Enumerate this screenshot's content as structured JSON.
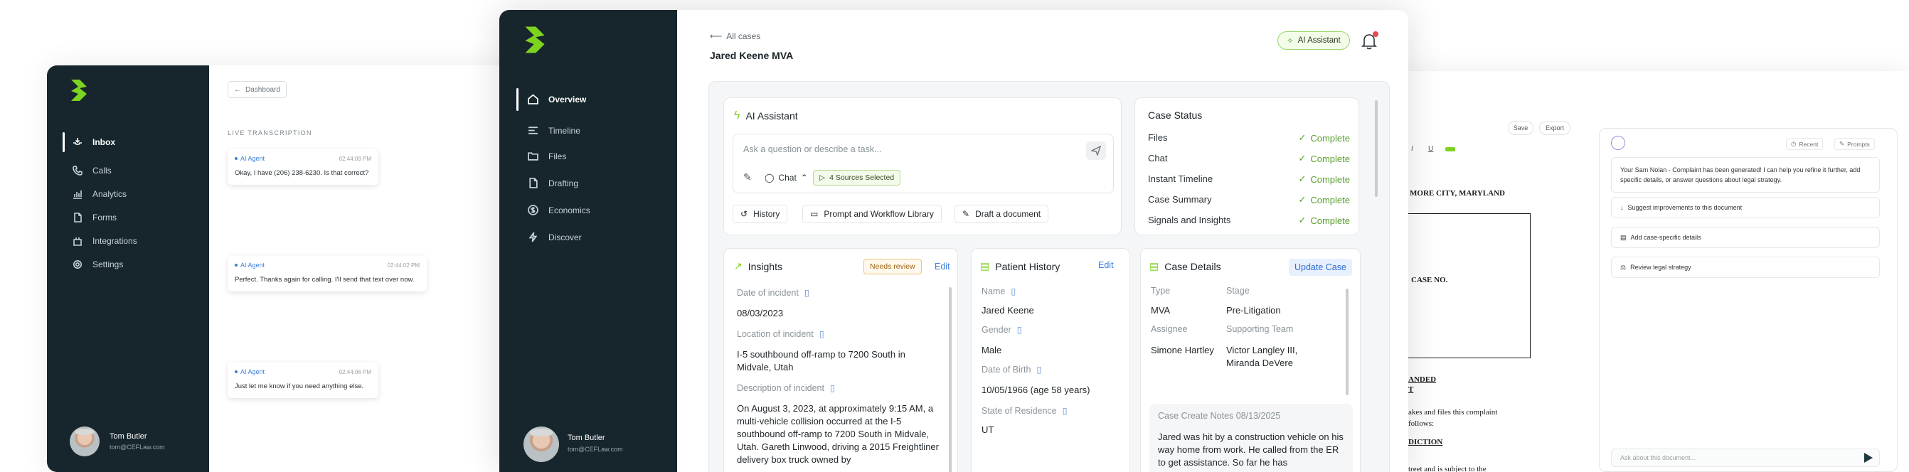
{
  "left_window": {
    "sidebar": {
      "items": [
        {
          "label": "Inbox",
          "icon": "inbox-icon",
          "active": true
        },
        {
          "label": "Calls",
          "icon": "phone-icon"
        },
        {
          "label": "Analytics",
          "icon": "analytics-icon"
        },
        {
          "label": "Forms",
          "icon": "file-icon"
        },
        {
          "label": "Integrations",
          "icon": "integrations-icon"
        },
        {
          "label": "Settings",
          "icon": "gear-icon"
        }
      ],
      "user": {
        "name": "Tom Butler",
        "email": "tom@CEFLaw.com"
      }
    },
    "back_label": "Dashboard",
    "live_label": "LIVE TRANSCRIPTION",
    "messages": [
      {
        "who": "AI Agent",
        "time": "02:44:09 PM",
        "text": "Okay, I have (206) 238-6230. Is that correct?"
      },
      {
        "who": "AI Agent",
        "time": "02:44:02 PM",
        "text": "Perfect. Thanks again for calling. I'll send that text over now."
      },
      {
        "who": "AI Agent",
        "time": "02:44:06 PM",
        "text": "Just let me know if you need anything else."
      }
    ]
  },
  "main_window": {
    "sidebar": {
      "items": [
        {
          "label": "Overview",
          "icon": "home-icon",
          "active": true
        },
        {
          "label": "Timeline",
          "icon": "timeline-icon"
        },
        {
          "label": "Files",
          "icon": "folder-icon"
        },
        {
          "label": "Drafting",
          "icon": "document-icon"
        },
        {
          "label": "Economics",
          "icon": "dollar-icon"
        },
        {
          "label": "Discover",
          "icon": "bolt-icon"
        }
      ],
      "user": {
        "name": "Tom Butler",
        "email": "tom@CEFLaw.com"
      }
    },
    "breadcrumb": "All cases",
    "case_title": "Jared Keene MVA",
    "ai_assistant_button": "AI Assistant",
    "ai_card": {
      "title": "AI Assistant",
      "placeholder": "Ask a question or describe a task...",
      "mode": "Chat",
      "sources": "4 Sources Selected",
      "chips": [
        "History",
        "Prompt and Workflow Library",
        "Draft a document"
      ]
    },
    "case_status": {
      "title": "Case Status",
      "rows": [
        {
          "label": "Files",
          "value": "Complete"
        },
        {
          "label": "Chat",
          "value": "Complete"
        },
        {
          "label": "Instant Timeline",
          "value": "Complete"
        },
        {
          "label": "Case Summary",
          "value": "Complete"
        },
        {
          "label": "Signals and Insights",
          "value": "Complete"
        }
      ]
    },
    "insights": {
      "title": "Insights",
      "badge": "Needs review",
      "edit": "Edit",
      "fields": [
        {
          "label": "Date of incident",
          "value": "08/03/2023"
        },
        {
          "label": "Location of incident",
          "value": "I-5 southbound off-ramp to 7200 South in Midvale, Utah"
        },
        {
          "label": "Description of incident",
          "value": "On August 3, 2023, at approximately 9:15 AM, a multi-vehicle collision occurred at the I-5 southbound off-ramp to 7200 South in Midvale, Utah. Gareth Linwood, driving a 2015 Freightliner delivery box truck owned by"
        }
      ]
    },
    "patient_history": {
      "title": "Patient History",
      "edit": "Edit",
      "fields": [
        {
          "label": "Name",
          "value": "Jared Keene"
        },
        {
          "label": "Gender",
          "value": "Male"
        },
        {
          "label": "Date of Birth",
          "value": "10/05/1966 (age 58 years)"
        },
        {
          "label": "State of Residence",
          "value": "UT"
        }
      ]
    },
    "case_details": {
      "title": "Case Details",
      "update": "Update Case",
      "type_label": "Type",
      "type_value": "MVA",
      "stage_label": "Stage",
      "stage_value": "Pre-Litigation",
      "assignee_label": "Assignee",
      "assignee_value": "Simone Hartley",
      "team_label": "Supporting Team",
      "team_value": "Victor Langley III, Miranda DeVere",
      "notes_title": "Case Create Notes 08/13/2025",
      "notes_text": "Jared was hit by a construction vehicle on his way home from work. He called from the ER to get assistance. So far he has"
    }
  },
  "right_window": {
    "toolbar": {
      "save": "Save",
      "export": "Export"
    },
    "format": [
      "I",
      "U"
    ],
    "doc_lines": [
      "MORE CITY, MARYLAND",
      "CASE NO.",
      "ANDED",
      "T",
      "akes and files this complaint",
      "follows:",
      "DICTION",
      "treet and is subject to the"
    ],
    "chat_panel": {
      "tabs": [
        "Recent",
        "Prompts"
      ],
      "bubble": "Your Sam Nolan - Complaint has been generated! I can help you refine it further, add specific details, or answer questions about legal strategy.",
      "suggestions": [
        "Suggest improvements to this document",
        "Add case-specific details",
        "Review legal strategy"
      ],
      "input_placeholder": "Ask about this document..."
    }
  },
  "colors": {
    "sidebar": "#16262c",
    "accent_green": "#7ed321",
    "link_blue": "#3b7ddd"
  }
}
